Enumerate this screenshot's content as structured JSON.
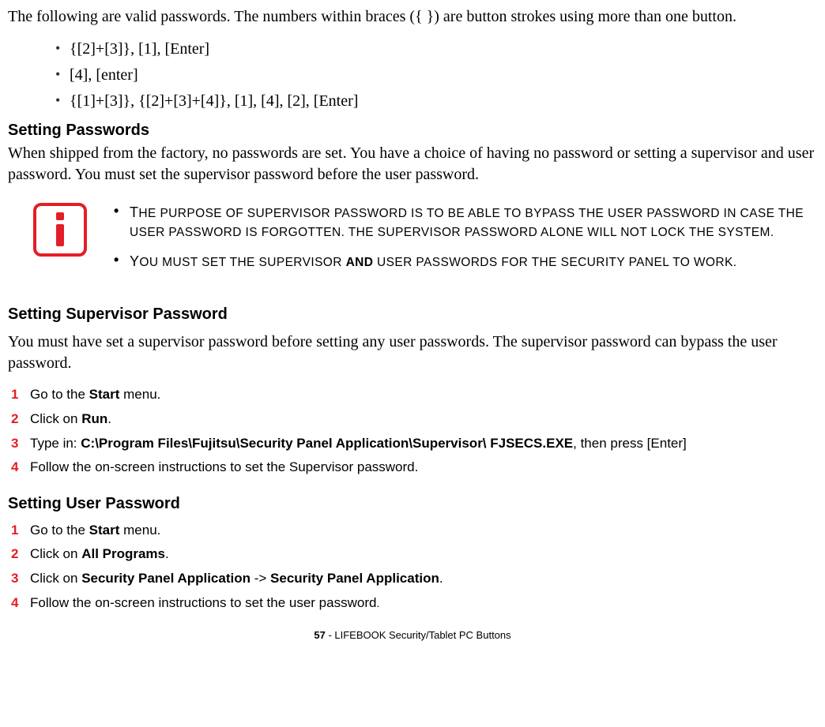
{
  "intro": "The following are valid passwords. The numbers within braces ({  }) are button strokes using more than one button.",
  "pw_examples": [
    "{[2]+[3]}, [1], [Enter]",
    "[4], [enter]",
    "{[1]+[3]}, {[2]+[3]+[4]}, [1], [4], [2], [Enter]"
  ],
  "setting_passwords_h": "Setting Passwords",
  "setting_passwords_body": "When shipped from the factory, no passwords are set. You have a choice of having no password or setting a supervisor and user password. You must set the supervisor password before the user password.",
  "info_bullets": [
    {
      "lead": "T",
      "rest_a": "HE PURPOSE OF SUPERVISOR PASSWORD IS TO BE ABLE TO BYPASS THE USER PASSWORD IN CASE THE USER PASSWORD IS FORGOTTEN. T",
      "rest_b": "HE SUPERVISOR PASSWORD ALONE WILL NOT LOCK THE SYSTEM."
    },
    {
      "lead": "Y",
      "rest_a": "OU MUST SET THE SUPERVISOR ",
      "bold": "AND",
      "rest_b": " USER PASSWORDS FOR THE SECURITY PANEL TO WORK."
    }
  ],
  "supervisor_h": "Setting Supervisor Password",
  "supervisor_body": "You must have set a supervisor password before setting any user passwords. The supervisor password can bypass the user password.",
  "supervisor_steps": [
    {
      "pre": "Go to the ",
      "b": "Start",
      "post": " menu."
    },
    {
      "pre": "Click on ",
      "b": "Run",
      "post": "."
    },
    {
      "pre": "Type in: ",
      "b": "C:\\Program Files\\Fujitsu\\Security Panel Application\\Supervisor\\ FJSECS.EXE",
      "post": ", then press [Enter]"
    },
    {
      "pre": "Follow the on-screen instructions to set the Supervisor password.",
      "b": "",
      "post": ""
    }
  ],
  "user_h": "Setting User Password",
  "user_steps": [
    {
      "pre": "Go to the ",
      "b": "Start",
      "post": " menu."
    },
    {
      "pre": "Click on ",
      "b": "All Programs",
      "post": "."
    },
    {
      "segments": [
        "Click on ",
        "Security Panel Application",
        " -> ",
        "Security Panel Application",
        "."
      ]
    },
    {
      "pre": "Follow the on-screen instructions to set the user password",
      "b": "",
      "post": "."
    }
  ],
  "footer_page": "57",
  "footer_text": " - LIFEBOOK Security/Tablet PC Buttons"
}
